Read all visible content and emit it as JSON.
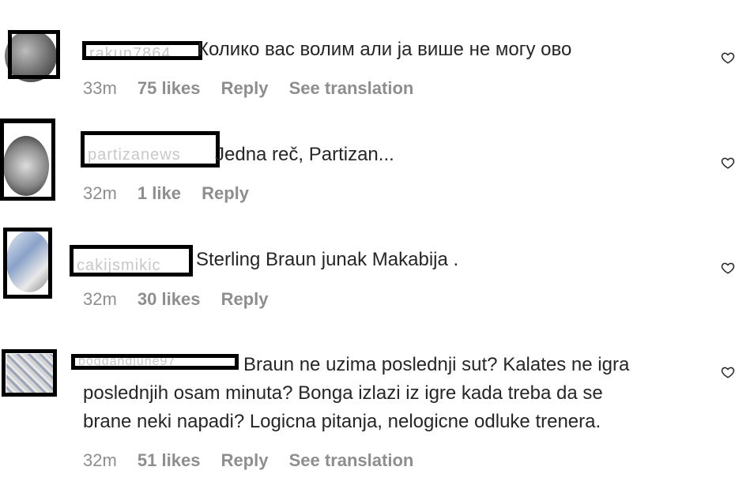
{
  "comments": [
    {
      "username": "rakun7864",
      "text": "Колико вас волим али ја више не могу ово",
      "time": "33m",
      "likes": "75 likes",
      "reply": "Reply",
      "translate": "See translation"
    },
    {
      "username": "partizanews",
      "text": "Jedna reč, Partizan...",
      "time": "32m",
      "likes": "1 like",
      "reply": "Reply"
    },
    {
      "username": "cakijsmikic",
      "text": "Sterling Braun junak Makabija .",
      "time": "32m",
      "likes": "30 likes",
      "reply": "Reply"
    },
    {
      "username": "bogdandjune97",
      "text_line1": "Braun ne uzima poslednji sut? Kalates ne igra",
      "text_line2": "poslednjih osam minuta? Bonga izlazi iz igre kada treba da se",
      "text_line3": "brane neki napadi? Logicna pitanja, nelogicne odluke trenera.",
      "time": "32m",
      "likes": "51 likes",
      "reply": "Reply",
      "translate": "See translation"
    }
  ]
}
